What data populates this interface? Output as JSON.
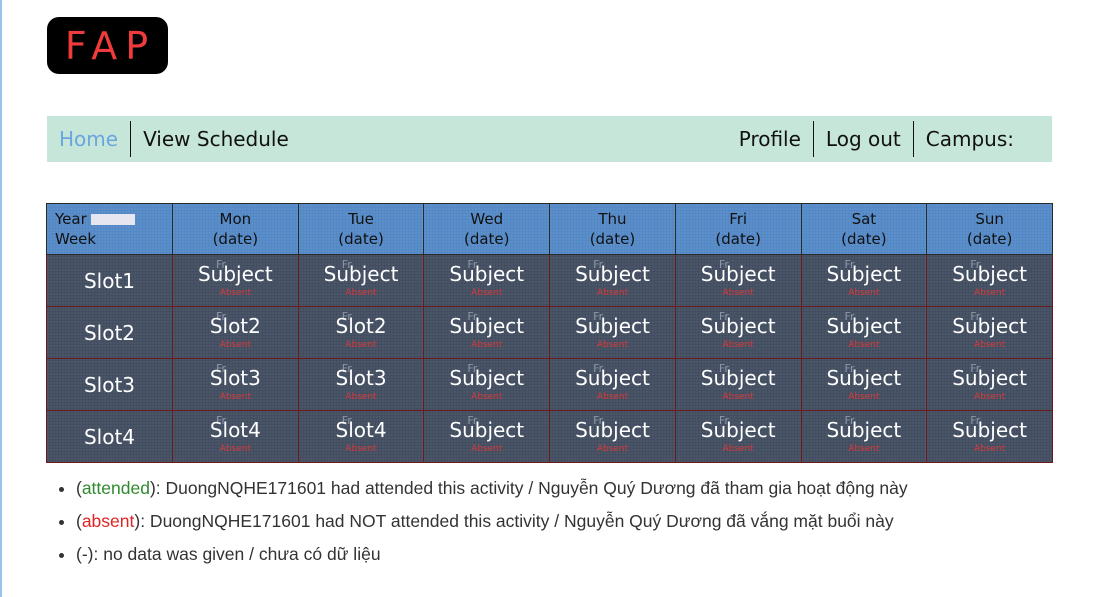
{
  "logo": {
    "text": "FAP"
  },
  "nav": {
    "home": "Home",
    "view_schedule": "View Schedule",
    "profile": "Profile",
    "logout": "Log out",
    "campus": "Campus:"
  },
  "timetable": {
    "year_label": "Year",
    "week_label": "Week",
    "days": [
      {
        "name": "Mon",
        "date": "(date)"
      },
      {
        "name": "Tue",
        "date": "(date)"
      },
      {
        "name": "Wed",
        "date": "(date)"
      },
      {
        "name": "Thu",
        "date": "(date)"
      },
      {
        "name": "Fri",
        "date": "(date)"
      },
      {
        "name": "Sat",
        "date": "(date)"
      },
      {
        "name": "Sun",
        "date": "(date)"
      }
    ],
    "rows": [
      {
        "slot": "Slot1",
        "cells": [
          "Subject",
          "Subject",
          "Subject",
          "Subject",
          "Subject",
          "Subject",
          "Subject"
        ]
      },
      {
        "slot": "Slot2",
        "cells": [
          "Slot2",
          "Slot2",
          "Subject",
          "Subject",
          "Subject",
          "Subject",
          "Subject"
        ]
      },
      {
        "slot": "Slot3",
        "cells": [
          "Slot3",
          "Slot3",
          "Subject",
          "Subject",
          "Subject",
          "Subject",
          "Subject"
        ]
      },
      {
        "slot": "Slot4",
        "cells": [
          "Slot4",
          "Slot4",
          "Subject",
          "Subject",
          "Subject",
          "Subject",
          "Subject"
        ]
      }
    ],
    "cell_ghost": "Fr",
    "cell_status": "Absent"
  },
  "legend": {
    "items": [
      {
        "open": "(",
        "status": "attended",
        "close": "): DuongNQHE171601 had attended this activity / Nguyễn Quý Dương đã tham gia hoạt động này"
      },
      {
        "open": "(",
        "status": "absent",
        "close": "): DuongNQHE171601 had NOT attended this activity / Nguyễn Quý Dương đã vắng mặt buổi này"
      },
      {
        "open": "",
        "status": "",
        "close": "(-): no data was given / chưa có dữ liệu"
      }
    ]
  },
  "colors": {
    "nav_bg": "#c5e6d9",
    "header_bg": "#4e85c4",
    "body_bg": "#3f4a5e",
    "attended": "#2e8b2e",
    "absent": "#e02424",
    "home_link": "#6ba6e0"
  }
}
